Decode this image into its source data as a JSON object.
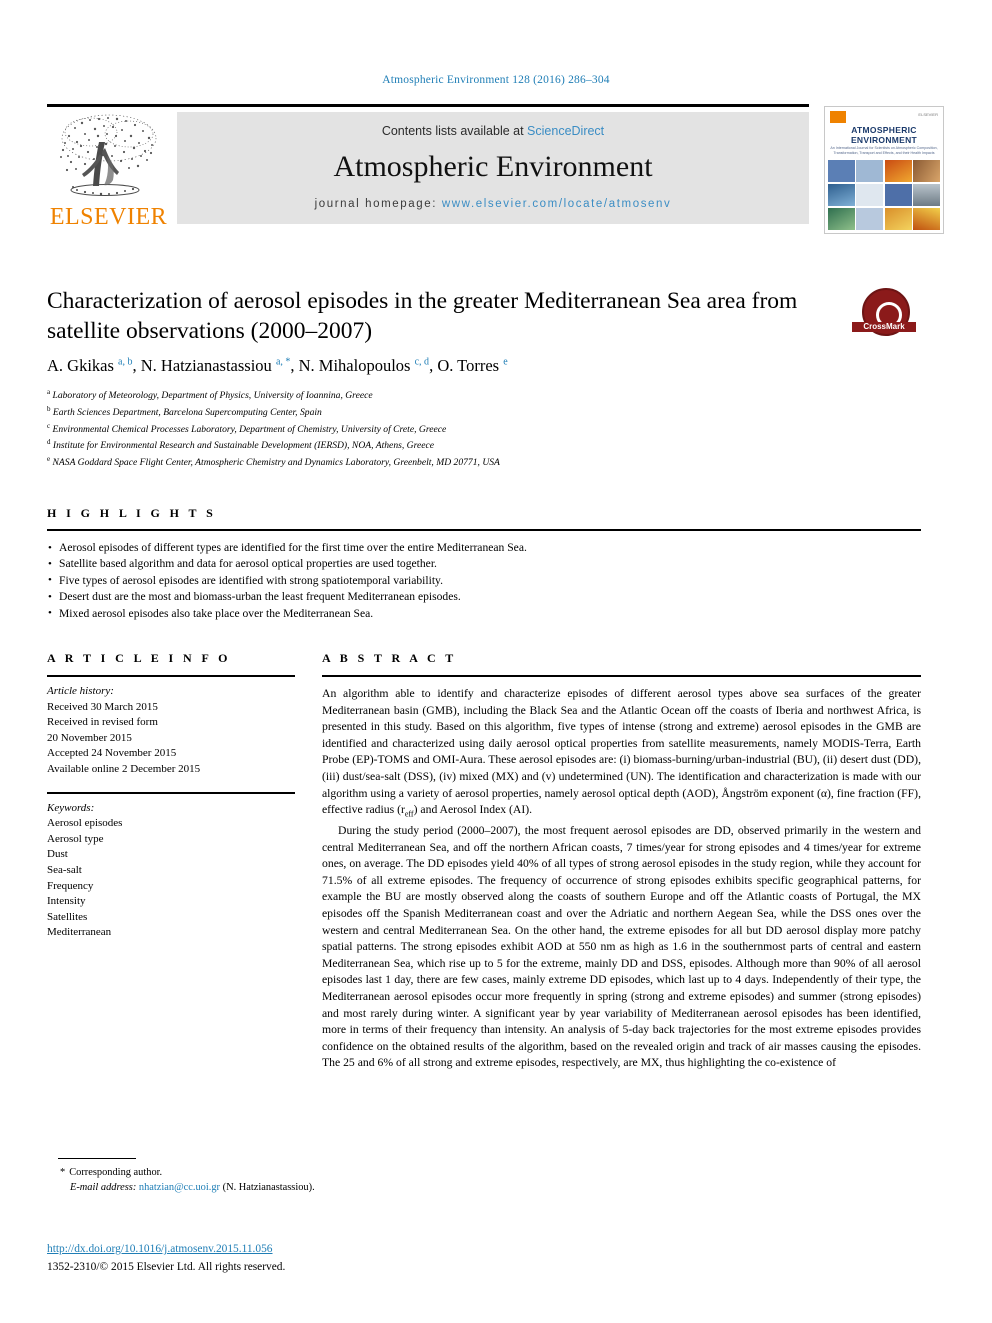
{
  "running_head": "Atmospheric Environment 128 (2016) 286–304",
  "masthead": {
    "contents_prefix": "Contents lists available at ",
    "sciencedirect": "ScienceDirect",
    "journal_name": "Atmospheric Environment",
    "homepage_prefix": "journal homepage: ",
    "homepage_url": "www.elsevier.com/locate/atmosenv",
    "publisher": "ELSEVIER",
    "publisher_color": "#ef8200",
    "link_color": "#3b8dc4"
  },
  "cover": {
    "title_line1": "ATMOSPHERIC",
    "title_line2": "ENVIRONMENT",
    "subtitle": "An International Journal for Scientists on Atmospheric Composition, Transformation, Transport and Effects, and their Health Impacts"
  },
  "article": {
    "title": "Characterization of aerosol episodes in the greater Mediterranean Sea area from satellite observations (2000–2007)",
    "crossmark_label": "CrossMark",
    "authors": [
      {
        "name": "A. Gkikas",
        "marks": "a, b",
        "sep": ", "
      },
      {
        "name": "N. Hatzianastassiou",
        "marks": "a, *",
        "sep": ", "
      },
      {
        "name": "N. Mihalopoulos",
        "marks": "c, d",
        "sep": ", "
      },
      {
        "name": "O. Torres",
        "marks": "e",
        "sep": ""
      }
    ],
    "affiliations": [
      {
        "mark": "a",
        "text": "Laboratory of Meteorology, Department of Physics, University of Ioannina, Greece"
      },
      {
        "mark": "b",
        "text": "Earth Sciences Department, Barcelona Supercomputing Center, Spain"
      },
      {
        "mark": "c",
        "text": "Environmental Chemical Processes Laboratory, Department of Chemistry, University of Crete, Greece"
      },
      {
        "mark": "d",
        "text": "Institute for Environmental Research and Sustainable Development (IERSD), NOA, Athens, Greece"
      },
      {
        "mark": "e",
        "text": "NASA Goddard Space Flight Center, Atmospheric Chemistry and Dynamics Laboratory, Greenbelt, MD 20771, USA"
      }
    ]
  },
  "highlights": {
    "heading": "H I G H L I G H T S",
    "items": [
      "Aerosol episodes of different types are identified for the first time over the entire Mediterranean Sea.",
      "Satellite based algorithm and data for aerosol optical properties are used together.",
      "Five types of aerosol episodes are identified with strong spatiotemporal variability.",
      "Desert dust are the most and biomass-urban the least frequent Mediterranean episodes.",
      "Mixed aerosol episodes also take place over the Mediterranean Sea."
    ]
  },
  "article_info": {
    "heading": "A R T I C L E   I N F O",
    "history_label": "Article history:",
    "history": [
      "Received 30 March 2015",
      "Received in revised form",
      "20 November 2015",
      "Accepted 24 November 2015",
      "Available online 2 December 2015"
    ],
    "keywords_label": "Keywords:",
    "keywords": [
      "Aerosol episodes",
      "Aerosol type",
      "Dust",
      "Sea-salt",
      "Frequency",
      "Intensity",
      "Satellites",
      "Mediterranean"
    ]
  },
  "abstract": {
    "heading": "A B S T R A C T",
    "paragraph1_part1": "An algorithm able to identify and characterize episodes of different aerosol types above sea surfaces of the greater Mediterranean basin (GMB), including the Black Sea and the Atlantic Ocean off the coasts of Iberia and northwest Africa, is presented in this study. Based on this algorithm, five types of intense (strong and extreme) aerosol episodes in the GMB are identified and characterized using daily aerosol optical properties from satellite measurements, namely MODIS-Terra, Earth Probe (EP)-TOMS and OMI-Aura. These aerosol episodes are: (i) biomass-burning/urban-industrial (BU), (ii) desert dust (DD), (iii) dust/sea-salt (DSS), (iv) mixed (MX) and (v) undetermined (UN). The identification and characterization is made with our algorithm using a variety of aerosol properties, namely aerosol optical depth (AOD), Ångström exponent (α), fine fraction (FF), effective radius (r",
    "paragraph1_sub": "eff",
    "paragraph1_part2": ") and Aerosol Index (AI).",
    "paragraph2": "During the study period (2000–2007), the most frequent aerosol episodes are DD, observed primarily in the western and central Mediterranean Sea, and off the northern African coasts, 7 times/year for strong episodes and 4 times/year for extreme ones, on average. The DD episodes yield 40% of all types of strong aerosol episodes in the study region, while they account for 71.5% of all extreme episodes. The frequency of occurrence of strong episodes exhibits specific geographical patterns, for example the BU are mostly observed along the coasts of southern Europe and off the Atlantic coasts of Portugal, the MX episodes off the Spanish Mediterranean coast and over the Adriatic and northern Aegean Sea, while the DSS ones over the western and central Mediterranean Sea. On the other hand, the extreme episodes for all but DD aerosol display more patchy spatial patterns. The strong episodes exhibit AOD at 550 nm as high as 1.6 in the southernmost parts of central and eastern Mediterranean Sea, which rise up to 5 for the extreme, mainly DD and DSS, episodes. Although more than 90% of all aerosol episodes last 1 day, there are few cases, mainly extreme DD episodes, which last up to 4 days. Independently of their type, the Mediterranean aerosol episodes occur more frequently in spring (strong and extreme episodes) and summer (strong episodes) and most rarely during winter. A significant year by year variability of Mediterranean aerosol episodes has been identified, more in terms of their frequency than intensity. An analysis of 5-day back trajectories for the most extreme episodes provides confidence on the obtained results of the algorithm, based on the revealed origin and track of air masses causing the episodes. The 25 and 6% of all strong and extreme episodes, respectively, are MX, thus highlighting the co-existence of"
  },
  "footer": {
    "corresponding_marker": "*",
    "corresponding_text": "Corresponding author.",
    "email_label": "E-mail address:",
    "email": "nhatzian@cc.uoi.gr",
    "email_owner": "(N. Hatzianastassiou).",
    "doi": "http://dx.doi.org/10.1016/j.atmosenv.2015.11.056",
    "copyright": "1352-2310/© 2015 Elsevier Ltd. All rights reserved."
  }
}
